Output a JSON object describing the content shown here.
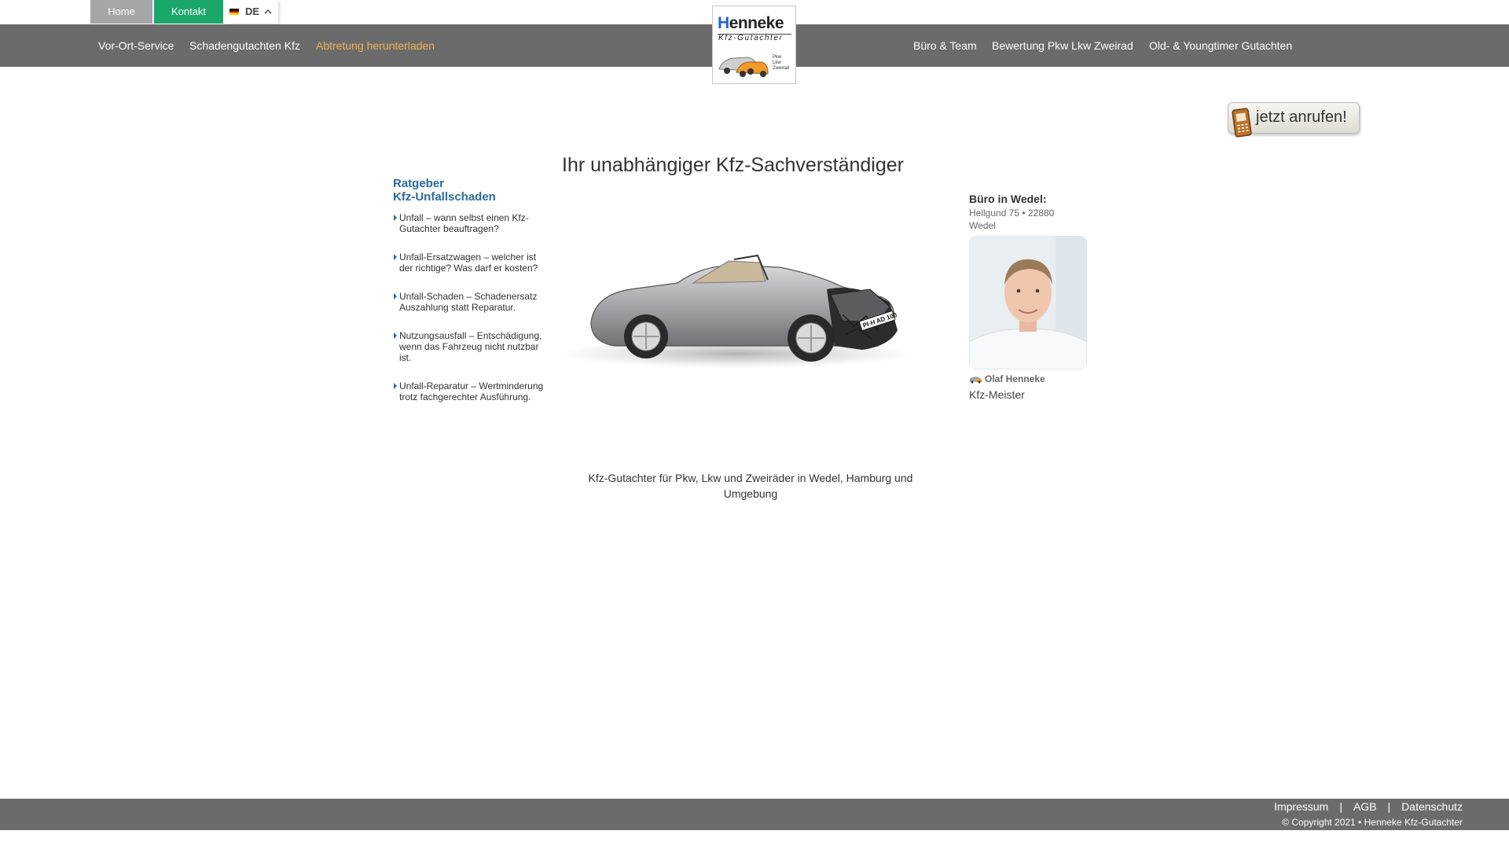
{
  "top": {
    "home_label": "Home",
    "contact_label": "Kontakt",
    "language": "DE"
  },
  "nav": {
    "left": [
      "Vor-Ort-Service",
      "Schadengutachten Kfz",
      "Abtretung herunterladen"
    ],
    "right": [
      "Büro & Team",
      "Bewertung Pkw Lkw Zweirad",
      "Old- & Youngtimer Gutachten"
    ],
    "active_color": "#f0b25a"
  },
  "logo": {
    "line1_first": "H",
    "line1_rest": "enneke",
    "line2": "Kfz-Gutachter",
    "tags": [
      "Pkw",
      "Lkw",
      "Zweirad"
    ]
  },
  "call_button": {
    "label": "jetzt anrufen!",
    "icon": "phone-icon"
  },
  "headline": "Ihr unabhängiger Kfz-Sachverständiger",
  "guide": {
    "title_line1": "Ratgeber",
    "title_line2": "Kfz-Unfallschaden",
    "items": [
      "Unfall – wann selbst einen Kfz-Gutachter beauftragen?",
      "Unfall-Ersatzwagen – welcher ist der richtige? Was darf er kosten?",
      "Unfall-Schaden – Schadenersatz Auszahlung statt Reparatur.",
      "Nutzungsausfall – Entschädigung, wenn das Fahrzeug nicht nutzbar ist.",
      "Unfall-Reparatur – Wertminderung trotz fachgerechter Ausführung."
    ]
  },
  "hero": {
    "plate": "PI-H AD 100"
  },
  "caption": "Kfz-Gutachter für Pkw, Lkw und Zweiräder in Wedel, Hamburg und Umgebung",
  "office": {
    "title": "Büro in Wedel:",
    "address": "Hellgund 75 • 22880 Wedel",
    "name": "Olaf Henneke",
    "role": "Kfz-Meister"
  },
  "footer": {
    "links": [
      "Impressum",
      "AGB",
      "Datenschutz"
    ],
    "separator": "|",
    "copyright": "© Copyright 2021 • Henneke Kfz-Gutachter"
  },
  "colors": {
    "nav_bg": "#6b6b6b",
    "home_tab": "#a5a5a5",
    "contact_tab": "#1aa76a",
    "guide_title": "#2a6b9c"
  }
}
